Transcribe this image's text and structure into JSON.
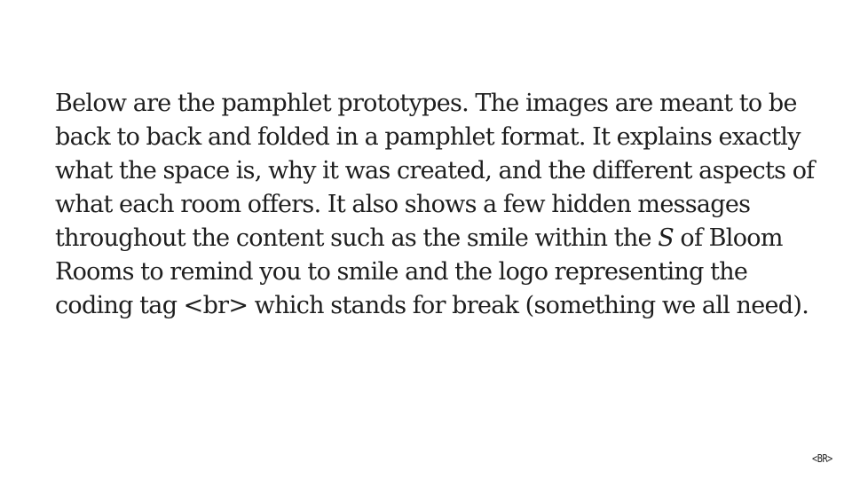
{
  "slide": {
    "paragraph": {
      "part1": "Below are the pamphlet prototypes. The images are meant to be back to back and folded in a pamphlet format. It explains exactly what the space is, why it was created, and the different aspects of what each room offers. It also shows a few hidden messages throughout the content such as the smile within the ",
      "emphasis": "S",
      "part2": " of Bloom Rooms to remind you to smile and the logo representing the coding tag <br> which stands for break (something we all need)."
    },
    "logo_text": "<BR>"
  }
}
